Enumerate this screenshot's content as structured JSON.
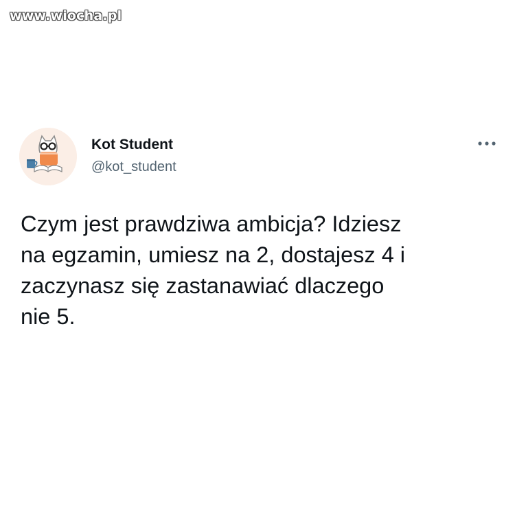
{
  "watermark": {
    "text": "www.wiocha.pl"
  },
  "tweet": {
    "author": {
      "display_name": "Kot Student",
      "handle": "@kot_student",
      "avatar_icon": "cat-student-avatar"
    },
    "more_icon": "more-horizontal-icon",
    "text": "Czym jest prawdziwa ambicja? Idziesz\nna egzamin, umiesz na 2, dostajesz 4 i\nzaczynasz się zastanawiać dlaczego\nnie 5."
  },
  "colors": {
    "text_primary": "#0f1419",
    "text_secondary": "#536471",
    "avatar_background": "#fbeee6",
    "accent_orange": "#f08a4b"
  }
}
